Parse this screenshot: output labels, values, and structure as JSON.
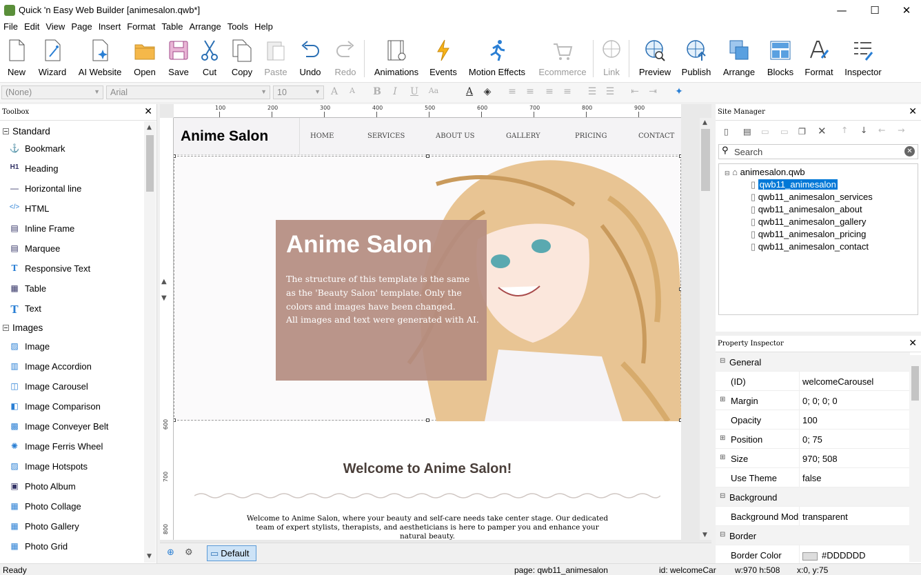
{
  "window": {
    "title": "Quick 'n Easy Web Builder [animesalon.qwb*]",
    "minimize": "—",
    "maximize": "☐",
    "close": "✕"
  },
  "menu": [
    "File",
    "Edit",
    "View",
    "Page",
    "Insert",
    "Format",
    "Table",
    "Arrange",
    "Tools",
    "Help"
  ],
  "toolbar": {
    "new": "New",
    "wizard": "Wizard",
    "ai_website": "AI Website",
    "open": "Open",
    "save": "Save",
    "cut": "Cut",
    "copy": "Copy",
    "paste": "Paste",
    "undo": "Undo",
    "redo": "Redo",
    "animations": "Animations",
    "events": "Events",
    "motion_effects": "Motion Effects",
    "ecommerce": "Ecommerce",
    "link": "Link",
    "preview": "Preview",
    "publish": "Publish",
    "arrange": "Arrange",
    "blocks": "Blocks",
    "format": "Format",
    "inspector": "Inspector"
  },
  "format_bar": {
    "style": "(None)",
    "font": "Arial",
    "size": "10"
  },
  "toolbox": {
    "title": "Toolbox",
    "standard_group": "Standard",
    "standard": [
      {
        "label": "Bookmark",
        "icon": "anchor-icon"
      },
      {
        "label": "Heading",
        "icon": "heading-icon"
      },
      {
        "label": "Horizontal line",
        "icon": "horizontal-line-icon"
      },
      {
        "label": "HTML",
        "icon": "html-code-icon"
      },
      {
        "label": "Inline Frame",
        "icon": "inline-frame-icon"
      },
      {
        "label": "Marquee",
        "icon": "marquee-icon"
      },
      {
        "label": "Responsive Text",
        "icon": "responsive-text-icon"
      },
      {
        "label": "Table",
        "icon": "table-icon"
      },
      {
        "label": "Text",
        "icon": "text-icon"
      }
    ],
    "images_group": "Images",
    "images": [
      {
        "label": "Image",
        "icon": "image-icon"
      },
      {
        "label": "Image Accordion",
        "icon": "image-accordion-icon"
      },
      {
        "label": "Image Carousel",
        "icon": "image-carousel-icon"
      },
      {
        "label": "Image Comparison",
        "icon": "image-comparison-icon"
      },
      {
        "label": "Image Conveyer Belt",
        "icon": "image-conveyer-icon"
      },
      {
        "label": "Image Ferris Wheel",
        "icon": "ferris-wheel-icon"
      },
      {
        "label": "Image Hotspots",
        "icon": "hotspots-icon"
      },
      {
        "label": "Photo Album",
        "icon": "photo-album-icon"
      },
      {
        "label": "Photo Collage",
        "icon": "photo-collage-icon"
      },
      {
        "label": "Photo Gallery",
        "icon": "photo-gallery-icon"
      },
      {
        "label": "Photo Grid",
        "icon": "photo-grid-icon"
      }
    ]
  },
  "ruler": {
    "h": [
      "100",
      "200",
      "300",
      "400",
      "500",
      "600",
      "700",
      "800",
      "900"
    ],
    "v": [
      "600",
      "700",
      "800"
    ]
  },
  "page_preview": {
    "logo": "Anime Salon",
    "nav": [
      "HOME",
      "SERVICES",
      "ABOUT US",
      "GALLERY",
      "PRICING",
      "CONTACT"
    ],
    "hero_title": "Anime Salon",
    "hero_text_1": "The structure of this template is the same as the 'Beauty Salon' template. Only the colors and images have been changed.",
    "hero_text_2": "All images and text were generated with AI.",
    "welcome_title": "Welcome to Anime Salon!",
    "welcome_text": "Welcome to Anime Salon, where your beauty and self-care needs take center stage. Our dedicated team of expert stylists, therapists, and aestheticians is here to pamper you and enhance your natural beauty."
  },
  "canvas_tab": "Default",
  "site_manager": {
    "title": "Site Manager",
    "search_placeholder": "Search",
    "root": "animesalon.qwb",
    "pages": [
      "qwb11_animesalon",
      "qwb11_animesalon_services",
      "qwb11_animesalon_about",
      "qwb11_animesalon_gallery",
      "qwb11_animesalon_pricing",
      "qwb11_animesalon_contact"
    ]
  },
  "property_inspector": {
    "title": "Property Inspector",
    "rows": [
      {
        "k": "General",
        "section": true
      },
      {
        "k": "(ID)",
        "v": "welcomeCarousel"
      },
      {
        "k": "Margin",
        "v": "0; 0; 0; 0",
        "expand": true
      },
      {
        "k": "Opacity",
        "v": "100"
      },
      {
        "k": "Position",
        "v": "0; 75",
        "expand": true
      },
      {
        "k": "Size",
        "v": "970; 508",
        "expand": true
      },
      {
        "k": "Use Theme",
        "v": "false"
      },
      {
        "k": "Background",
        "section": true
      },
      {
        "k": "Background Mod",
        "v": "transparent"
      },
      {
        "k": "Border",
        "section": true
      },
      {
        "k": "Border Color",
        "v": "#DDDDDD"
      }
    ]
  },
  "status": {
    "ready": "Ready",
    "page": "page: qwb11_animesalon",
    "id": "id: welcomeCar",
    "size": "w:970 h:508",
    "pos": "x:0, y:75"
  },
  "colors": {
    "accent": "#0078d7",
    "hero_box": "#b48c80",
    "selection": "#0078d7"
  }
}
